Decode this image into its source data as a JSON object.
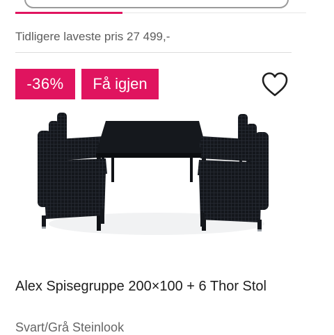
{
  "price": {
    "previous_lowest": "Tidligere laveste pris 27 499,-"
  },
  "badges": {
    "discount": "-36%",
    "again": "Få igjen"
  },
  "favorite": {
    "icon": "heart-outline-icon"
  },
  "product": {
    "title": "Alex Spisegruppe 200×100 + 6 Thor Stol",
    "variant": "Svart/Grå Steinlook"
  },
  "colors": {
    "accent": "#e0145f",
    "badge_text": "#ffffff",
    "furniture": "#14171c"
  }
}
